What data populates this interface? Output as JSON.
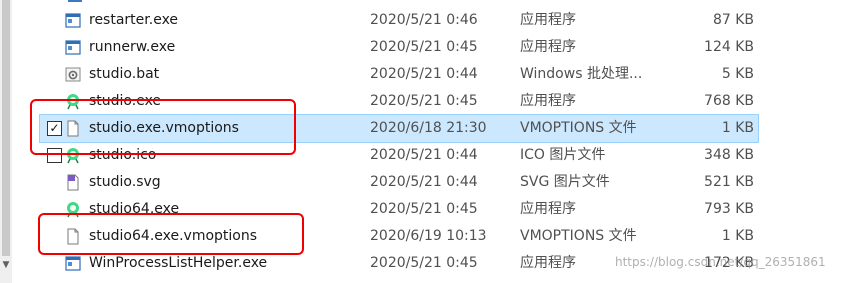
{
  "files": [
    {
      "name": "restarter.exe",
      "date": "2020/5/21 0:46",
      "type": "应用程序",
      "size": "87 KB",
      "icon": "exe-window-icon"
    },
    {
      "name": "runnerw.exe",
      "date": "2020/5/21 0:45",
      "type": "应用程序",
      "size": "124 KB",
      "icon": "exe-window-icon"
    },
    {
      "name": "studio.bat",
      "date": "2020/5/21 0:44",
      "type": "Windows 批处理...",
      "size": "5 KB",
      "icon": "bat-gear-icon"
    },
    {
      "name": "studio.exe",
      "date": "2020/5/21 0:45",
      "type": "应用程序",
      "size": "768 KB",
      "icon": "android-studio-icon"
    },
    {
      "name": "studio.exe.vmoptions",
      "date": "2020/6/18 21:30",
      "type": "VMOPTIONS 文件",
      "size": "1 KB",
      "icon": "document-icon",
      "selected": true,
      "checked": true
    },
    {
      "name": "studio.ico",
      "date": "2020/5/21 0:44",
      "type": "ICO 图片文件",
      "size": "348 KB",
      "icon": "android-studio-icon",
      "checked": false
    },
    {
      "name": "studio.svg",
      "date": "2020/5/21 0:44",
      "type": "SVG 图片文件",
      "size": "521 KB",
      "icon": "svg-file-icon"
    },
    {
      "name": "studio64.exe",
      "date": "2020/5/21 0:45",
      "type": "应用程序",
      "size": "793 KB",
      "icon": "android-studio-icon"
    },
    {
      "name": "studio64.exe.vmoptions",
      "date": "2020/6/19 10:13",
      "type": "VMOPTIONS 文件",
      "size": "1 KB",
      "icon": "document-icon"
    },
    {
      "name": "WinProcessListHelper.exe",
      "date": "2020/5/21 0:45",
      "type": "应用程序",
      "size": "172 KB",
      "icon": "exe-window-icon"
    }
  ],
  "watermark": "https://blog.csdn.net/qq_26351861",
  "colors": {
    "selection": "#cce8ff",
    "annotation": "#f00000"
  }
}
